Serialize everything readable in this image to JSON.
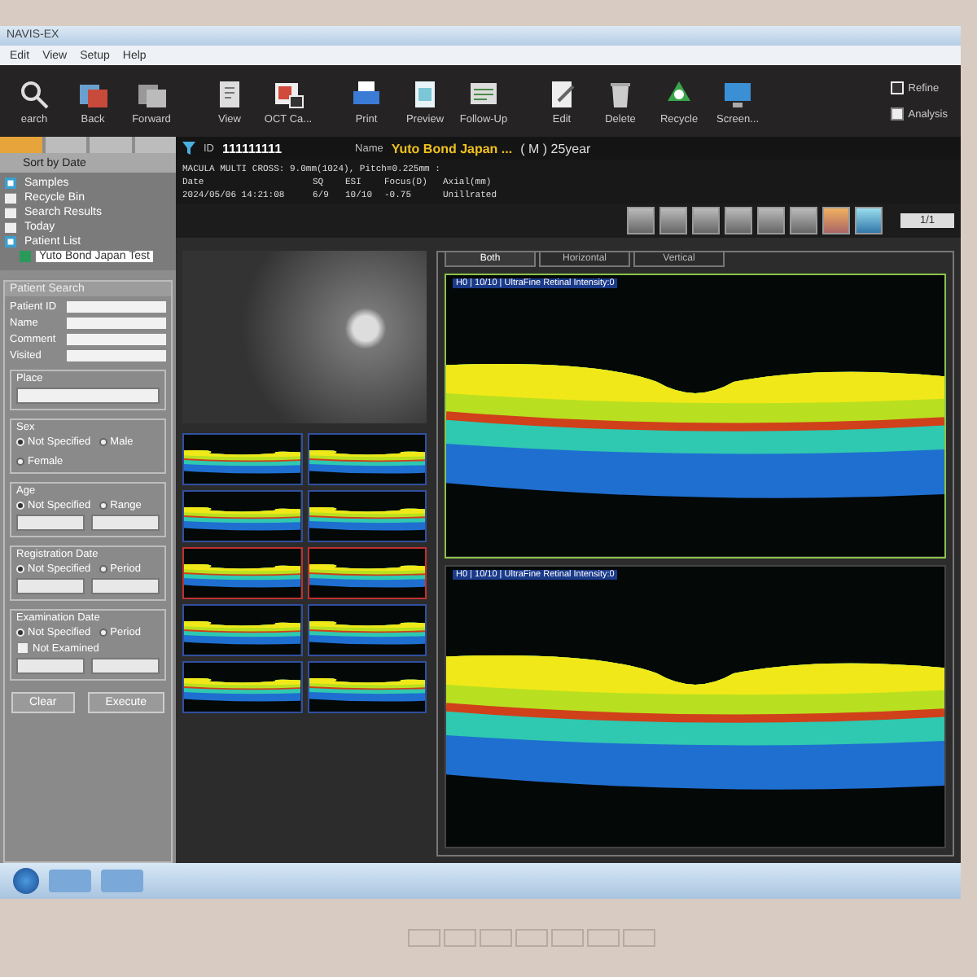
{
  "window": {
    "title": "NAVIS-EX"
  },
  "menu": [
    "Edit",
    "View",
    "Setup",
    "Help"
  ],
  "toolbar": [
    {
      "label": "earch",
      "kind": "search"
    },
    {
      "label": "Back",
      "kind": "back"
    },
    {
      "label": "Forward",
      "kind": "forward"
    },
    {
      "label": "View",
      "kind": "view"
    },
    {
      "label": "OCT Ca...",
      "kind": "camera"
    },
    {
      "label": "Print",
      "kind": "print"
    },
    {
      "label": "Preview",
      "kind": "preview"
    },
    {
      "label": "Follow-Up",
      "kind": "followup"
    },
    {
      "label": "Edit",
      "kind": "edit"
    },
    {
      "label": "Delete",
      "kind": "delete"
    },
    {
      "label": "Recycle",
      "kind": "recycle"
    },
    {
      "label": "Screen...",
      "kind": "screen"
    }
  ],
  "options": [
    {
      "label": "Refine",
      "checked": true
    },
    {
      "label": "Analysis",
      "checked": false
    }
  ],
  "sidebar": {
    "tabs": [
      {
        "selected": true
      },
      {
        "selected": false
      },
      {
        "selected": false
      },
      {
        "selected": false
      }
    ],
    "sort": "Sort by Date",
    "tree": [
      {
        "label": "Samples",
        "kind": "samples"
      },
      {
        "label": "Recycle Bin",
        "kind": "folder"
      },
      {
        "label": "Search Results",
        "kind": "folder"
      },
      {
        "label": "Today",
        "kind": "folder"
      },
      {
        "label": "Patient List",
        "kind": "samples",
        "children": [
          {
            "label": "Yuto Bond Japan Test",
            "selected": true
          }
        ]
      }
    ]
  },
  "search_panel": {
    "title": "Patient Search",
    "fields": [
      "Patient ID",
      "Name",
      "Comment",
      "Visited"
    ],
    "groups": [
      {
        "title": "Place",
        "kind": "select"
      },
      {
        "title": "Sex",
        "kind": "radios",
        "options": [
          {
            "label": "Not Specified",
            "selected": true
          },
          {
            "label": "Male",
            "selected": false
          },
          {
            "label": "Female",
            "selected": false
          }
        ]
      },
      {
        "title": "Age",
        "kind": "range",
        "options": [
          {
            "label": "Not Specified",
            "selected": true
          },
          {
            "label": "Range",
            "selected": false
          }
        ]
      },
      {
        "title": "Registration Date",
        "kind": "range",
        "options": [
          {
            "label": "Not Specified",
            "selected": true
          },
          {
            "label": "Period",
            "selected": false
          }
        ]
      },
      {
        "title": "Examination Date",
        "kind": "range",
        "options": [
          {
            "label": "Not Specified",
            "selected": true
          },
          {
            "label": "Period",
            "selected": false
          }
        ],
        "extra": {
          "label": "Not Examined",
          "checked": false
        }
      }
    ],
    "buttons": [
      "Clear",
      "Execute"
    ]
  },
  "patient": {
    "id_label": "ID",
    "id": "111111111",
    "name_label": "Name",
    "name": "Yuto Bond Japan ...",
    "sex_age": "( M ) 25year"
  },
  "exam": {
    "protocol": "MACULA MULTI CROSS: 9.0mm(1024), Pitch=0.225mm :",
    "columns": [
      "Date",
      "SQ",
      "ESI",
      "Focus(D)",
      "Axial(mm)"
    ],
    "row": [
      "2024/05/06 14:21:08",
      "6/9",
      "10/10",
      "-0.75",
      "Unillrated"
    ]
  },
  "pager": "1/1",
  "view_tabs": [
    {
      "label": "Both",
      "selected": true
    },
    {
      "label": "Horizontal",
      "selected": false
    },
    {
      "label": "Vertical",
      "selected": false
    }
  ],
  "thumbnails": [
    {
      "selected": false
    },
    {
      "selected": false
    },
    {
      "selected": false
    },
    {
      "selected": false
    },
    {
      "selected": true
    },
    {
      "selected": true
    },
    {
      "selected": false
    },
    {
      "selected": false
    },
    {
      "selected": false
    },
    {
      "selected": false
    }
  ],
  "scans": [
    {
      "caption": "H0 | 10/10 | UltraFine Retinal Intensity:0",
      "selected": true
    },
    {
      "caption": "H0 | 10/10 | UltraFine Retinal Intensity:0",
      "selected": false
    }
  ]
}
